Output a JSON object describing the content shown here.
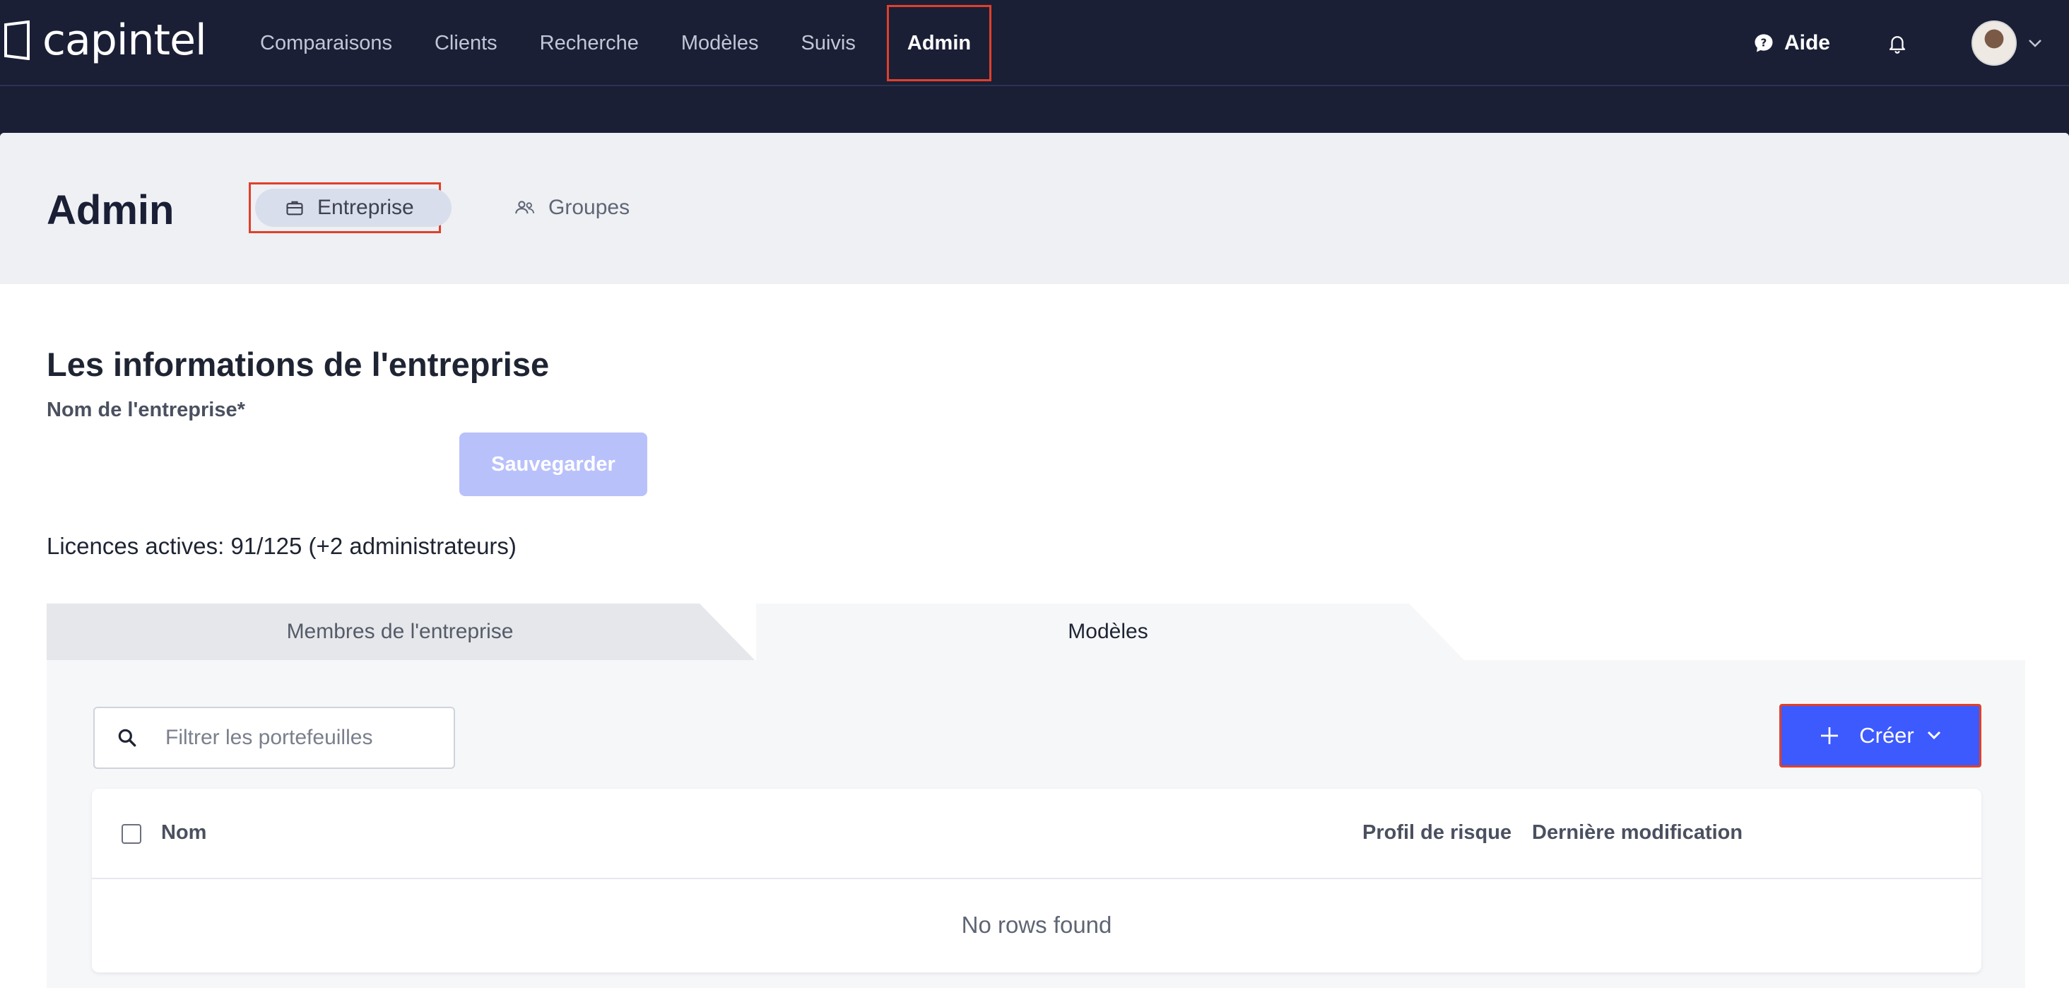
{
  "app": {
    "logo_text": "capintel"
  },
  "nav": {
    "items": [
      {
        "label": "Comparaisons"
      },
      {
        "label": "Clients"
      },
      {
        "label": "Recherche"
      },
      {
        "label": "Modèles"
      },
      {
        "label": "Suivis"
      },
      {
        "label": "Admin",
        "active": true
      }
    ],
    "help_label": "Aide",
    "help_icon": "chat-question-icon",
    "bell_icon": "bell-icon"
  },
  "header": {
    "title": "Admin",
    "tabs": [
      {
        "label": "Entreprise",
        "icon": "briefcase-icon",
        "active": true
      },
      {
        "label": "Groupes",
        "icon": "users-icon"
      }
    ]
  },
  "company": {
    "section_title": "Les informations de l'entreprise",
    "name_label": "Nom de l'entreprise*",
    "name_value": "",
    "save_label": "Sauvegarder",
    "licences": "Licences actives: 91/125 (+2 administrateurs)"
  },
  "panel": {
    "tabs": [
      {
        "label": "Membres de l'entreprise"
      },
      {
        "label": "Modèles",
        "active": true
      }
    ],
    "search": {
      "placeholder": "Filtrer les portefeuilles",
      "value": ""
    },
    "create_label": "Créer",
    "table": {
      "columns": [
        "Nom",
        "Profil de risque",
        "Dernière modification"
      ],
      "rows": [],
      "empty_text": "No rows found"
    }
  },
  "colors": {
    "topbar": "#1a1f36",
    "accent": "#3d5afe",
    "highlight": "#e0402a",
    "save_disabled": "#b9c1fb"
  }
}
